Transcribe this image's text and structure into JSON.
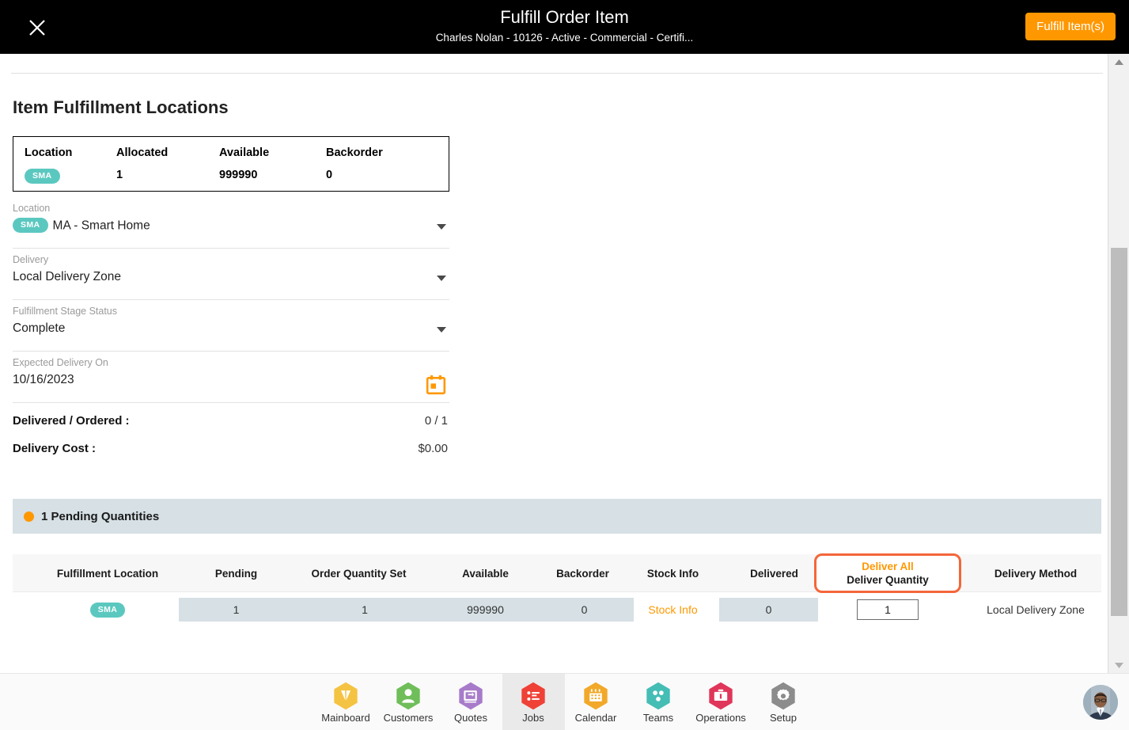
{
  "header": {
    "title": "Fulfill Order Item",
    "subtitle": "Charles Nolan - 10126 - Active - Commercial - Certifi...",
    "close_label": "close-icon",
    "action_label": "Fulfill Item(s)"
  },
  "main": {
    "page_title": "Item Fulfillment Locations",
    "summary_table": {
      "columns": [
        "Location",
        "Allocated",
        "Available",
        "Backorder"
      ],
      "rows": [
        {
          "location_badge": "SMA",
          "allocated": "1",
          "available": "999990",
          "backorder": "0"
        }
      ]
    },
    "fields": [
      {
        "label": "Location",
        "badge": "SMA",
        "value": "MA - Smart Home",
        "control": "dropdown"
      },
      {
        "label": "Delivery",
        "badge": "",
        "value": "Local Delivery Zone",
        "control": "dropdown"
      },
      {
        "label": "Fulfillment Stage Status",
        "badge": "",
        "value": "Complete",
        "control": "dropdown"
      },
      {
        "label": "Expected Delivery On",
        "badge": "",
        "value": "10/16/2023",
        "control": "datepicker"
      }
    ],
    "totals": [
      {
        "label": "Delivered / Ordered :",
        "value": "0 / 1"
      },
      {
        "label": "Delivery Cost :",
        "value": "$0.00"
      }
    ],
    "pending_banner": {
      "text": "1 Pending Quantities",
      "dot_color": "#FF9800",
      "background": "#D6E0E5"
    },
    "grid": {
      "columns": [
        "Fulfillment Location",
        "Pending",
        "Order Quantity Set",
        "Available",
        "Backorder",
        "Stock Info",
        "Delivered",
        "Delivery Method"
      ],
      "deliver_all_label": "Deliver All",
      "deliver_quantity_label": "Deliver Quantity",
      "rows": [
        {
          "fulfillment_location": "SMA",
          "pending": "1",
          "order_quantity_set": "1",
          "available": "999990",
          "backorder": "0",
          "stock_info": "Stock Info",
          "delivered": "0",
          "deliver_quantity": "1",
          "delivery_method": "Local Delivery Zone"
        }
      ]
    }
  },
  "bottom_nav": {
    "items": [
      {
        "label": "Mainboard",
        "icon": "mainboard-icon",
        "color": "#F5C council"
      },
      {
        "label": "Customers",
        "icon": "customers-icon",
        "color": "#6FBE5A"
      },
      {
        "label": "Quotes",
        "icon": "quotes-icon",
        "color": "#A77BCA"
      },
      {
        "label": "Jobs",
        "icon": "jobs-icon",
        "color": "#EF4136"
      },
      {
        "label": "Calendar",
        "icon": "calendar-icon",
        "color": "#F2A829"
      },
      {
        "label": "Teams",
        "icon": "teams-icon",
        "color": "#44BDB5"
      },
      {
        "label": "Operations",
        "icon": "operations-icon",
        "color": "#E0365A"
      },
      {
        "label": "Setup",
        "icon": "setup-icon",
        "color": "#8C8C8C"
      }
    ],
    "active": "Jobs",
    "avatar_label": "user-avatar"
  },
  "colors": {
    "accent_orange": "#FF9800",
    "highlight_border": "#F4663A",
    "badge_teal": "#5BC8C0",
    "banner_blue_gray": "#D6E0E5",
    "header_black": "#000000"
  },
  "scrollbar": {
    "position": "middle"
  }
}
